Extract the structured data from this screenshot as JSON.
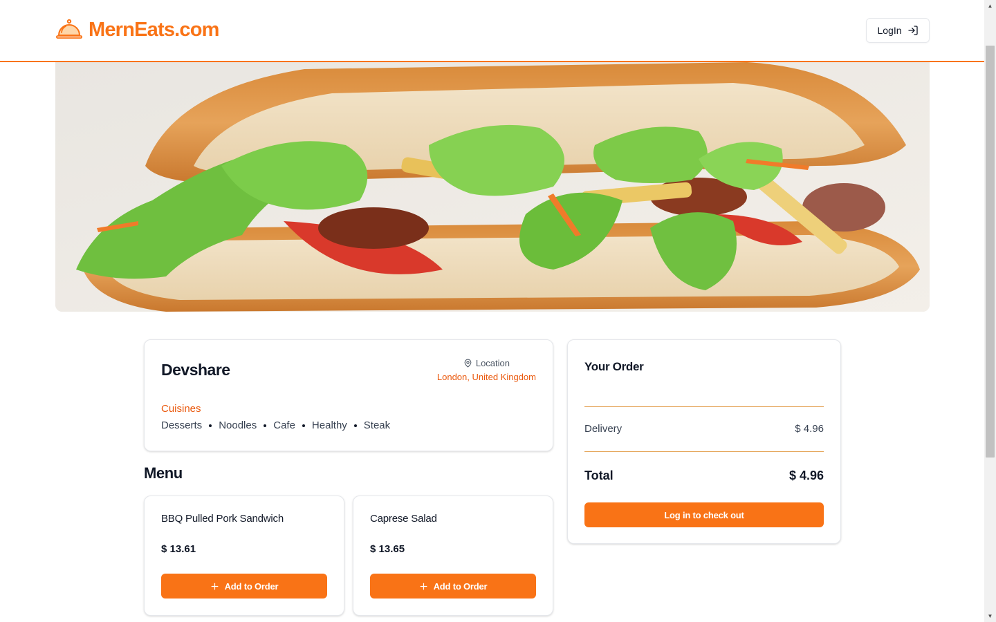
{
  "header": {
    "brand_name": "MernEats.com",
    "brand_icon": "cloche-icon",
    "login_label": "LogIn",
    "login_icon": "log-in-icon"
  },
  "hero": {
    "image": "sandwich-photo"
  },
  "restaurant": {
    "name": "Devshare",
    "location_label": "Location",
    "location_icon": "map-pin-icon",
    "location_value": "London, United Kingdom",
    "cuisines_title": "Cuisines",
    "cuisines": [
      "Desserts",
      "Noodles",
      "Cafe",
      "Healthy",
      "Steak"
    ]
  },
  "menu": {
    "title": "Menu",
    "items": [
      {
        "name": "BBQ Pulled Pork Sandwich",
        "price": "$ 13.61",
        "button_label": "Add to Order"
      },
      {
        "name": "Caprese Salad",
        "price": "$ 13.65",
        "button_label": "Add to Order"
      }
    ]
  },
  "order": {
    "title": "Your Order",
    "delivery_label": "Delivery",
    "delivery_value": "$ 4.96",
    "total_label": "Total",
    "total_value": "$ 4.96",
    "checkout_label": "Log in to check out"
  },
  "colors": {
    "accent": "#f97316",
    "accent_text": "#ea580c"
  }
}
